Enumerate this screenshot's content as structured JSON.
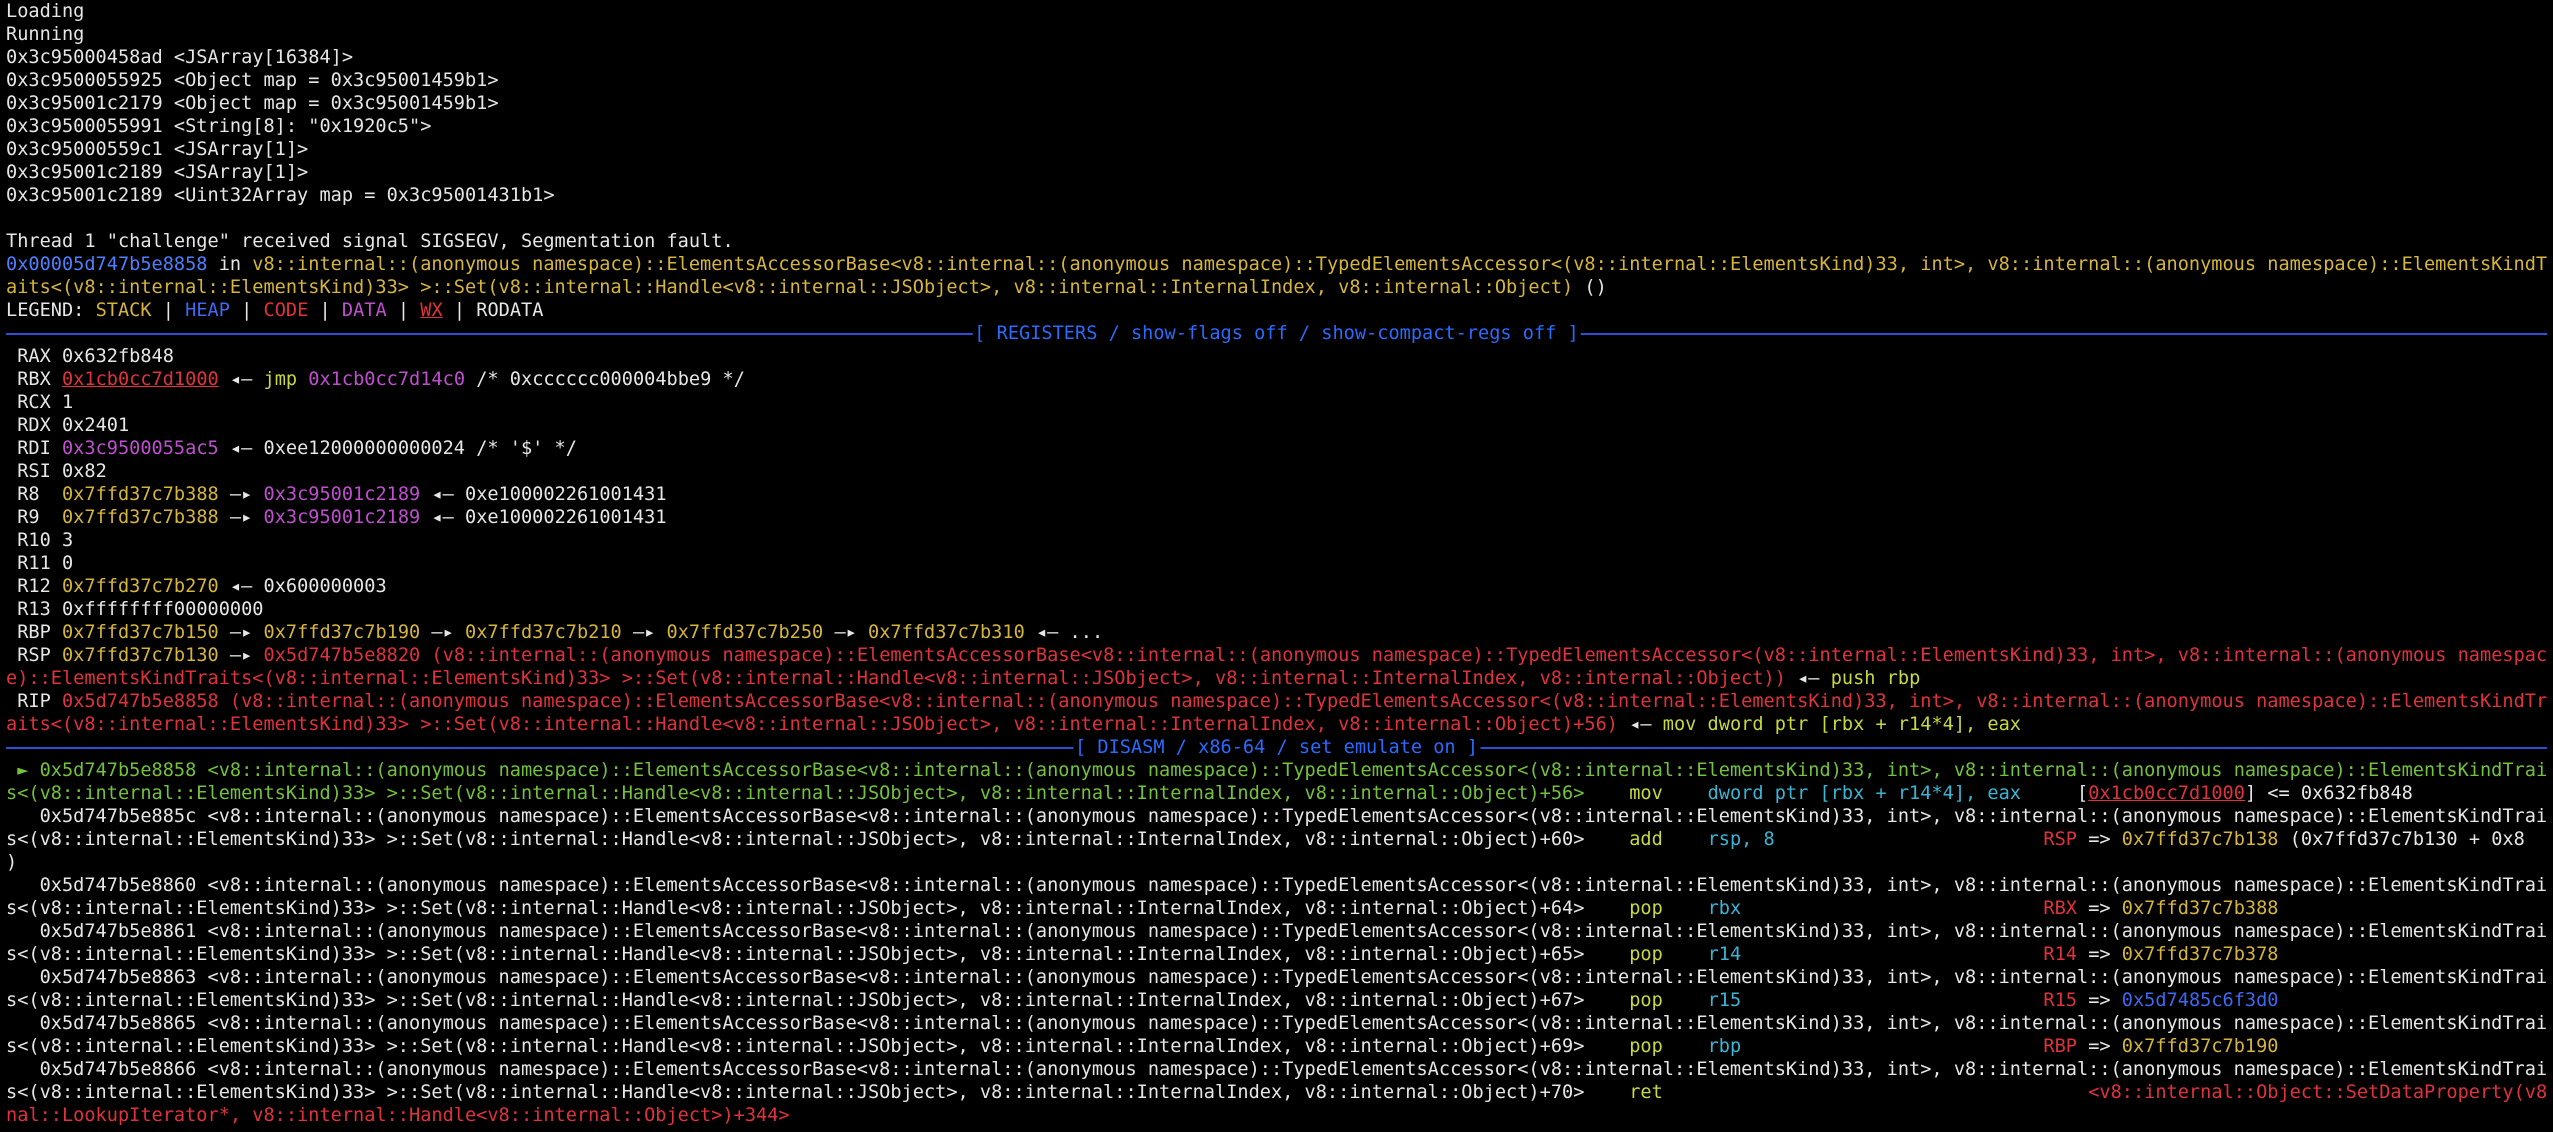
{
  "output": {
    "l1": "Loading",
    "l2": "Running",
    "l3": "0x3c95000458ad <JSArray[16384]>",
    "l4": "0x3c9500055925 <Object map = 0x3c95001459b1>",
    "l5": "0x3c95001c2179 <Object map = 0x3c95001459b1>",
    "l6": "0x3c9500055991 <String[8]: \"0x1920c5\">",
    "l7": "0x3c95000559c1 <JSArray[1]>",
    "l8": "0x3c95001c2189 <JSArray[1]>",
    "l9": "0x3c95001c2189 <Uint32Array map = 0x3c95001431b1>"
  },
  "signal": {
    "text": "Thread 1 \"challenge\" received signal SIGSEGV, Segmentation fault.",
    "addr": "0x00005d747b5e8858",
    "in": " in ",
    "func1": "v8::internal::(anonymous namespace)::ElementsAccessorBase<v8::internal::(anonymous namespace)::TypedElementsAccessor<(v8::internal::ElementsKind)33, int>, v8::internal::(anonymous namespace)::ElementsKindTr",
    "func2": "aits<(v8::internal::ElementsKind)33> >::Set(v8::internal::Handle<v8::internal::JSObject>, v8::internal::InternalIndex, v8::internal::Object)",
    "func2_tail": " ()"
  },
  "legend": {
    "label": "LEGEND: ",
    "stack": "STACK",
    "heap": "HEAP",
    "code": "CODE",
    "data": "DATA",
    "wx": "WX",
    "rodata": "RODATA",
    "sep": " | "
  },
  "registers_header": "[ REGISTERS / show-flags off / show-compact-regs off ]",
  "disasm_header": "[ DISASM / x86-64 / set emulate on ]",
  "registers": {
    "rax": {
      "name": " RAX ",
      "value": "0x632fb848"
    },
    "rbx": {
      "name": " RBX ",
      "value": "0x1cb0cc7d1000",
      "arrow": " ◂— ",
      "op": "jmp",
      "target": "0x1cb0cc7d14c0",
      "comment": " /* 0xcccccc000004bbe9 */"
    },
    "rcx": {
      "name": " RCX ",
      "value": "1"
    },
    "rdx": {
      "name": " RDX ",
      "value": "0x2401"
    },
    "rdi": {
      "name": " RDI ",
      "value": "0x3c9500055ac5",
      "rest": " ◂— 0xee12000000000024 /* '$' */"
    },
    "rsi": {
      "name": " RSI ",
      "value": "0x82"
    },
    "r8": {
      "name": " R8  ",
      "value": "0x7ffd37c7b388",
      "arrow": " —▸ ",
      "ptr": "0x3c95001c2189",
      "rest": " ◂— 0xe100002261001431"
    },
    "r9": {
      "name": " R9  ",
      "value": "0x7ffd37c7b388",
      "arrow": " —▸ ",
      "ptr": "0x3c95001c2189",
      "rest": " ◂— 0xe100002261001431"
    },
    "r10": {
      "name": " R10 ",
      "value": "3"
    },
    "r11": {
      "name": " R11 ",
      "value": "0"
    },
    "r12": {
      "name": " R12 ",
      "value": "0x7ffd37c7b270",
      "rest": " ◂— 0x600000003"
    },
    "r13": {
      "name": " R13 ",
      "value": "0xffffffff00000000"
    },
    "rbp": {
      "name": " RBP ",
      "value": "0x7ffd37c7b150",
      "a1": " —▸ ",
      "v2": "0x7ffd37c7b190",
      "a2": " —▸ ",
      "v3": "0x7ffd37c7b210",
      "a3": " —▸ ",
      "v4": "0x7ffd37c7b250",
      "a4": " —▸ ",
      "v5": "0x7ffd37c7b310",
      "rest": " ◂— ..."
    },
    "rsp": {
      "name": " RSP ",
      "value": "0x7ffd37c7b130",
      "arrow": " —▸ ",
      "func_addr": "0x5d747b5e8820",
      "func1": " (v8::internal::(anonymous namespace)::ElementsAccessorBase<v8::internal::(anonymous namespace)::TypedElementsAccessor<(v8::internal::ElementsKind)33, int>, v8::internal::(anonymous namespac",
      "func2": "e)::ElementsKindTraits<(v8::internal::ElementsKind)33> >::Set(v8::internal::Handle<v8::internal::JSObject>, v8::internal::InternalIndex, v8::internal::Object))",
      "arrow2": " ◂— ",
      "instr": "push rbp"
    },
    "rip": {
      "name": " RIP ",
      "value": "0x5d747b5e8858",
      "func1": " (v8::internal::(anonymous namespace)::ElementsAccessorBase<v8::internal::(anonymous namespace)::TypedElementsAccessor<(v8::internal::ElementsKind)33, int>, v8::internal::(anonymous namespace)::ElementsKindTr",
      "func2": "aits<(v8::internal::ElementsKind)33> >::Set(v8::internal::Handle<v8::internal::JSObject>, v8::internal::InternalIndex, v8::internal::Object)+56)",
      "arrow2": " ◂— ",
      "instr": "mov dword ptr [rbx + r14*4], eax"
    }
  },
  "disasm": {
    "i0": {
      "marker": " ► ",
      "line1": "0x5d747b5e8858 <v8::internal::(anonymous namespace)::ElementsAccessorBase<v8::internal::(anonymous namespace)::TypedElementsAccessor<(v8::internal::ElementsKind)33, int>, v8::internal::(anonymous namespace)::ElementsKindTrait",
      "line2": "s<(v8::internal::ElementsKind)33> >::Set(v8::internal::Handle<v8::internal::JSObject>, v8::internal::InternalIndex, v8::internal::Object)+56>",
      "mnem": "    mov    ",
      "ops": "dword ptr [rbx + r14*4], eax",
      "pad": "     ",
      "eff_open": "[",
      "eff_addr": "0x1cb0cc7d1000",
      "eff_close": "] <= 0x632fb848"
    },
    "i1": {
      "line1": "   0x5d747b5e885c <v8::internal::(anonymous namespace)::ElementsAccessorBase<v8::internal::(anonymous namespace)::TypedElementsAccessor<(v8::internal::ElementsKind)33, int>, v8::internal::(anonymous namespace)::ElementsKindTrait",
      "line2": "s<(v8::internal::ElementsKind)33> >::Set(v8::internal::Handle<v8::internal::JSObject>, v8::internal::InternalIndex, v8::internal::Object)+60>",
      "mnem": "    add    ",
      "ops": "rsp, 8",
      "pad": "                        ",
      "eff_reg": "RSP",
      "eff_arrow": " => ",
      "eff_val": "0x7ffd37c7b138",
      "eff_tail": " (0x7ffd37c7b130 + 0x8",
      "line3": ")"
    },
    "i2": {
      "line1": "   0x5d747b5e8860 <v8::internal::(anonymous namespace)::ElementsAccessorBase<v8::internal::(anonymous namespace)::TypedElementsAccessor<(v8::internal::ElementsKind)33, int>, v8::internal::(anonymous namespace)::ElementsKindTrait",
      "line2": "s<(v8::internal::ElementsKind)33> >::Set(v8::internal::Handle<v8::internal::JSObject>, v8::internal::InternalIndex, v8::internal::Object)+64>",
      "mnem": "    pop    ",
      "ops": "rbx",
      "pad": "                           ",
      "eff_reg": "RBX",
      "eff_arrow": " => ",
      "eff_val": "0x7ffd37c7b388"
    },
    "i3": {
      "line1": "   0x5d747b5e8861 <v8::internal::(anonymous namespace)::ElementsAccessorBase<v8::internal::(anonymous namespace)::TypedElementsAccessor<(v8::internal::ElementsKind)33, int>, v8::internal::(anonymous namespace)::ElementsKindTrait",
      "line2": "s<(v8::internal::ElementsKind)33> >::Set(v8::internal::Handle<v8::internal::JSObject>, v8::internal::InternalIndex, v8::internal::Object)+65>",
      "mnem": "    pop    ",
      "ops": "r14",
      "pad": "                           ",
      "eff_reg": "R14",
      "eff_arrow": " => ",
      "eff_val": "0x7ffd37c7b378"
    },
    "i4": {
      "line1": "   0x5d747b5e8863 <v8::internal::(anonymous namespace)::ElementsAccessorBase<v8::internal::(anonymous namespace)::TypedElementsAccessor<(v8::internal::ElementsKind)33, int>, v8::internal::(anonymous namespace)::ElementsKindTrait",
      "line2": "s<(v8::internal::ElementsKind)33> >::Set(v8::internal::Handle<v8::internal::JSObject>, v8::internal::InternalIndex, v8::internal::Object)+67>",
      "mnem": "    pop    ",
      "ops": "r15",
      "pad": "                           ",
      "eff_reg": "R15",
      "eff_arrow": " => ",
      "eff_val": "0x5d7485c6f3d0"
    },
    "i5": {
      "line1": "   0x5d747b5e8865 <v8::internal::(anonymous namespace)::ElementsAccessorBase<v8::internal::(anonymous namespace)::TypedElementsAccessor<(v8::internal::ElementsKind)33, int>, v8::internal::(anonymous namespace)::ElementsKindTrait",
      "line2": "s<(v8::internal::ElementsKind)33> >::Set(v8::internal::Handle<v8::internal::JSObject>, v8::internal::InternalIndex, v8::internal::Object)+69>",
      "mnem": "    pop    ",
      "ops": "rbp",
      "pad": "                           ",
      "eff_reg": "RBP",
      "eff_arrow": " => ",
      "eff_val": "0x7ffd37c7b190"
    },
    "i6": {
      "line1": "   0x5d747b5e8866 <v8::internal::(anonymous namespace)::ElementsAccessorBase<v8::internal::(anonymous namespace)::TypedElementsAccessor<(v8::internal::ElementsKind)33, int>, v8::internal::(anonymous namespace)::ElementsKindTrait",
      "line2": "s<(v8::internal::ElementsKind)33> >::Set(v8::internal::Handle<v8::internal::JSObject>, v8::internal::InternalIndex, v8::internal::Object)+70>",
      "mnem": "    ret",
      "pad": "                                      ",
      "ret_target1": "<v8::internal::Object::SetDataProperty(v8::inter",
      "line3": "nal::LookupIterator*, v8::internal::Handle<v8::internal::Object>)+344>"
    }
  }
}
